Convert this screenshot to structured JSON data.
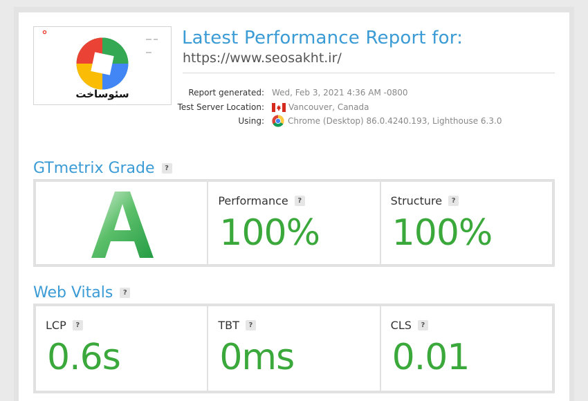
{
  "report": {
    "title": "Latest Performance Report for:",
    "url": "https://www.seosakht.ir/"
  },
  "thumbnail": {
    "logo_text": "سئوساخت"
  },
  "meta": [
    {
      "label": "Report generated:",
      "value": "Wed, Feb 3, 2021 4:36 AM -0800",
      "icon": "none"
    },
    {
      "label": "Test Server Location:",
      "value": "Vancouver, Canada",
      "icon": "canada-flag-icon"
    },
    {
      "label": "Using:",
      "value": "Chrome (Desktop) 86.0.4240.193, Lighthouse 6.3.0",
      "icon": "chrome-icon"
    }
  ],
  "grade": {
    "heading": "GTmetrix Grade",
    "letter": "A",
    "help": "?",
    "performance": {
      "label": "Performance",
      "value": "100%",
      "help": "?"
    },
    "structure": {
      "label": "Structure",
      "value": "100%",
      "help": "?"
    }
  },
  "vitals": {
    "heading": "Web Vitals",
    "help": "?",
    "lcp": {
      "label": "LCP",
      "value": "0.6s",
      "help": "?"
    },
    "tbt": {
      "label": "TBT",
      "value": "0ms",
      "help": "?"
    },
    "cls": {
      "label": "CLS",
      "value": "0.01",
      "help": "?"
    }
  },
  "colors": {
    "accent": "#3a9bd5",
    "good": "#3aa83a",
    "grade": "#34a853"
  }
}
